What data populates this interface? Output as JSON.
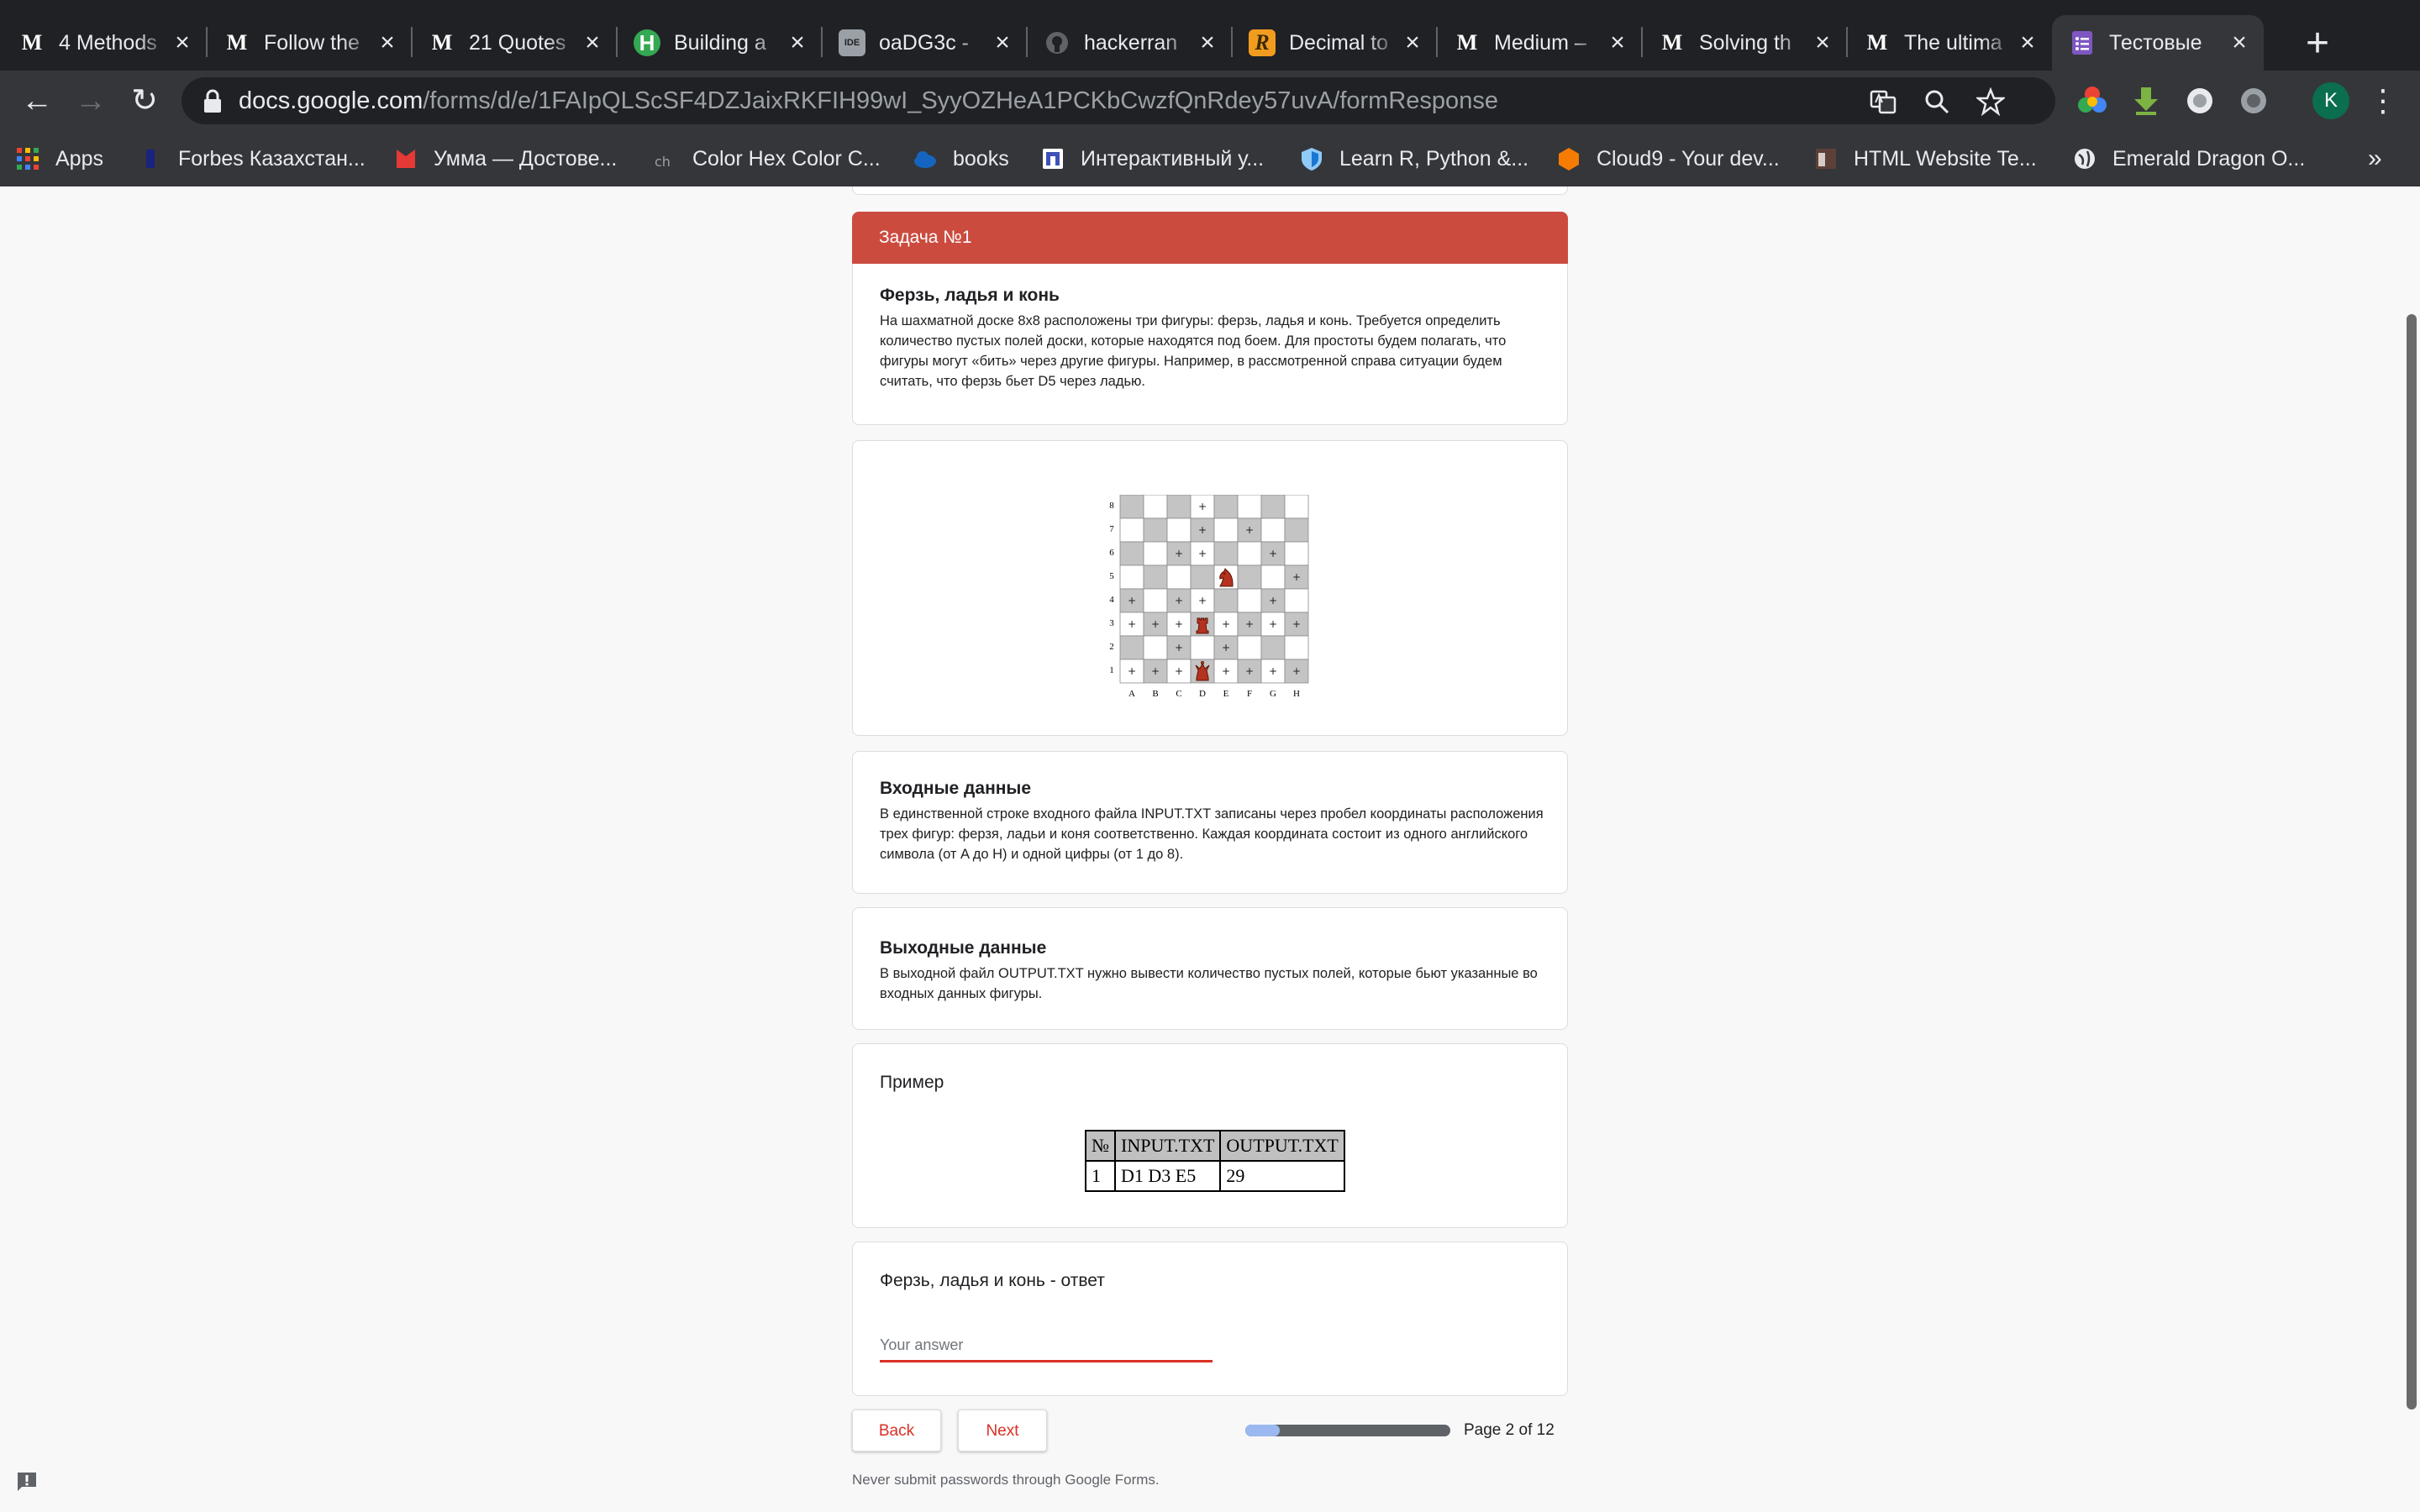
{
  "tabs": [
    {
      "title": "4 Methods",
      "icon": "medium-icon"
    },
    {
      "title": "Follow the",
      "icon": "medium-icon"
    },
    {
      "title": "21 Quotes",
      "icon": "medium-icon"
    },
    {
      "title": "Building a",
      "icon": "hyperskill-icon"
    },
    {
      "title": "oaDG3c -",
      "icon": "ideone-icon"
    },
    {
      "title": "hackerran",
      "icon": "github-icon"
    },
    {
      "title": "Decimal to",
      "icon": "r-icon"
    },
    {
      "title": "Medium –",
      "icon": "medium-icon"
    },
    {
      "title": "Solving th",
      "icon": "medium-icon"
    },
    {
      "title": "The ultima",
      "icon": "medium-icon"
    },
    {
      "title": "Тестовые",
      "icon": "google-forms-icon",
      "active": true
    }
  ],
  "favicon_letters": {
    "medium": "M",
    "hyperskill": "H",
    "ideone": "IDE",
    "r": "R"
  },
  "address_bar": {
    "domain": "docs.google.com",
    "path": "/forms/d/e/1FAIpQLScSF4DZJaixRKFIH99wI_SyyOZHeA1PCKbCwzfQnRdey57uvA/formResponse"
  },
  "profile_initial": "K",
  "bookmarks": [
    {
      "label": "Apps",
      "icon": "apps-grid-icon"
    },
    {
      "label": "Forbes Казахстан...",
      "icon": "forbes-icon"
    },
    {
      "label": "Умма — Достове...",
      "icon": "umma-icon"
    },
    {
      "label": "Color Hex Color C...",
      "icon": "colorhex-icon"
    },
    {
      "label": "books",
      "icon": "cloud-icon"
    },
    {
      "label": "Интерактивный у...",
      "icon": "interactive-icon"
    },
    {
      "label": "Learn R, Python &...",
      "icon": "shield-icon"
    },
    {
      "label": "Cloud9 - Your dev...",
      "icon": "cloud9-icon"
    },
    {
      "label": "HTML Website Te...",
      "icon": "template-icon"
    },
    {
      "label": "Emerald Dragon O...",
      "icon": "globe-icon"
    }
  ],
  "bookmarks_more": "»",
  "section": {
    "header": "Задача №1",
    "title": "Ферзь, ладья и конь",
    "description": "На шахматной доске 8х8 расположены три фигуры: ферзь, ладья и конь. Требуется определить количество пустых полей доски, которые находятся под боем. Для простоты будем полагать, что фигуры могут «бить» через другие фигуры. Например, в рассмотренной справа ситуации будем считать, что ферзь бьет D5 через ладью."
  },
  "board": {
    "files": [
      "A",
      "B",
      "C",
      "D",
      "E",
      "F",
      "G",
      "H"
    ],
    "ranks": [
      "8",
      "7",
      "6",
      "5",
      "4",
      "3",
      "2",
      "1"
    ],
    "attacked_mark": "+",
    "attacked": {
      "8": [
        3
      ],
      "7": [
        3,
        5
      ],
      "6": [
        2,
        3,
        6
      ],
      "5": [
        7
      ],
      "4": [
        0,
        2,
        3,
        6
      ],
      "3": [
        0,
        1,
        2,
        4,
        5,
        6,
        7
      ],
      "2": [
        2,
        4
      ],
      "1": [
        0,
        1,
        2,
        4,
        5,
        6,
        7
      ]
    },
    "pieces": [
      {
        "type": "knight",
        "square": "E5"
      },
      {
        "type": "rook",
        "square": "D3"
      },
      {
        "type": "queen",
        "square": "D1"
      }
    ]
  },
  "input_section": {
    "title": "Входные данные",
    "description": "В единственной строке входного файла INPUT.TXT записаны через пробел координаты расположения трех фигур: ферзя, ладьи и коня соответственно. Каждая координата состоит из одного английского символа (от A до H) и одной цифры (от 1 до 8)."
  },
  "output_section": {
    "title": "Выходные данные",
    "description": "В выходной файл OUTPUT.TXT нужно вывести количество пустых полей, которые бьют указанные во входных данных фигуры."
  },
  "example": {
    "title": "Пример",
    "headers": [
      "№",
      "INPUT.TXT",
      "OUTPUT.TXT"
    ],
    "rows": [
      [
        "1",
        "D1 D3 E5",
        "29"
      ]
    ]
  },
  "answer": {
    "question": "Ферзь, ладья и конь - ответ",
    "placeholder": "Your answer",
    "value": ""
  },
  "nav": {
    "back": "Back",
    "next": "Next"
  },
  "progress": {
    "label": "Page 2 of 12",
    "fraction": 0.1667
  },
  "footer": "Never submit passwords through Google Forms.",
  "colors": {
    "header_red": "#cc4b3f",
    "accent_red": "#d93025",
    "progress_blue": "#9bb9f0"
  }
}
